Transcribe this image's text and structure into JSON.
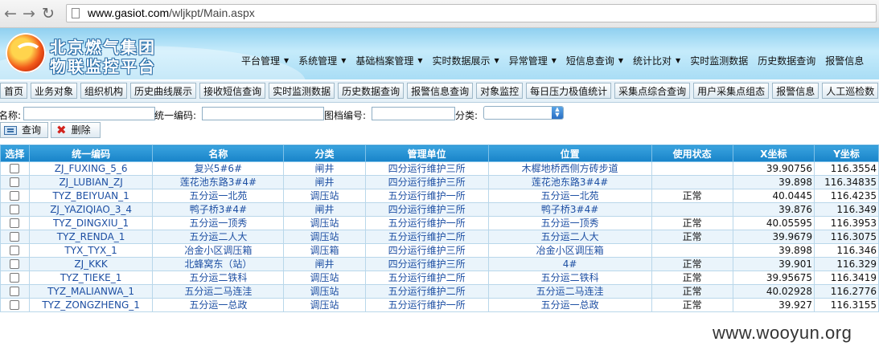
{
  "browser": {
    "url_domain": "www.gasiot.com",
    "url_path": "/wljkpt/Main.aspx"
  },
  "header": {
    "org_name": "北京燃气集团",
    "platform_name": "物联监控平台",
    "menu": [
      {
        "label": "平台管理",
        "dropdown": true
      },
      {
        "label": "系统管理",
        "dropdown": true
      },
      {
        "label": "基础档案管理",
        "dropdown": true
      },
      {
        "label": "实时数据展示",
        "dropdown": true
      },
      {
        "label": "异常管理",
        "dropdown": true
      },
      {
        "label": "短信息查询",
        "dropdown": true
      },
      {
        "label": "统计比对",
        "dropdown": true
      },
      {
        "label": "实时监测数据",
        "dropdown": false
      },
      {
        "label": "历史数据查询",
        "dropdown": false
      },
      {
        "label": "报警信息",
        "dropdown": false
      }
    ]
  },
  "tabs": [
    "首页",
    "业务对象",
    "组织机构",
    "历史曲线展示",
    "接收短信查询",
    "实时监测数据",
    "历史数据查询",
    "报警信息查询",
    "对象监控",
    "每日压力极值统计",
    "采集点综合查询",
    "用户采集点组态",
    "报警信息",
    "人工巡检数"
  ],
  "form": {
    "name_label": "名称:",
    "code_label": "统一编码:",
    "archive_label": "图档编号:",
    "category_label": "分类:",
    "query_button": "查询",
    "delete_button": "删除"
  },
  "table": {
    "headers": [
      "选择",
      "统一编码",
      "名称",
      "分类",
      "管理单位",
      "位置",
      "使用状态",
      "X坐标",
      "Y坐标"
    ],
    "rows": [
      [
        "ZJ_FUXING_5_6",
        "复兴5#6#",
        "闸井",
        "四分运行维护三所",
        "木樨地桥西侧方砖步道",
        "",
        "39.90756",
        "116.3554"
      ],
      [
        "ZJ_LUBIAN_ZJ",
        "莲花池东路3#4#",
        "闸井",
        "四分运行维护三所",
        "莲花池东路3#4#",
        "",
        "39.898",
        "116.34835"
      ],
      [
        "TYZ_BEIYUAN_1",
        "五分运一北苑",
        "调压站",
        "五分运行维护一所",
        "五分运一北苑",
        "正常",
        "40.0445",
        "116.4235"
      ],
      [
        "ZJ_YAZIQIAO_3_4",
        "鸭子桥3#4#",
        "闸井",
        "四分运行维护三所",
        "鸭子桥3#4#",
        "",
        "39.876",
        "116.349"
      ],
      [
        "TYZ_DINGXIU_1",
        "五分运一顶秀",
        "调压站",
        "五分运行维护一所",
        "五分运一顶秀",
        "正常",
        "40.05595",
        "116.3953"
      ],
      [
        "TYZ_RENDA_1",
        "五分运二人大",
        "调压站",
        "五分运行维护二所",
        "五分运二人大",
        "正常",
        "39.9679",
        "116.3075"
      ],
      [
        "TYX_TYX_1",
        "冶金小区调压箱",
        "调压箱",
        "四分运行维护三所",
        "冶金小区调压箱",
        "",
        "39.898",
        "116.346"
      ],
      [
        "ZJ_KKK",
        "北蜂窝东（站）",
        "闸井",
        "四分运行维护三所",
        "4#",
        "正常",
        "39.901",
        "116.329"
      ],
      [
        "TYZ_TIEKE_1",
        "五分运二铁科",
        "调压站",
        "五分运行维护二所",
        "五分运二铁科",
        "正常",
        "39.95675",
        "116.3419"
      ],
      [
        "TYZ_MALIANWA_1",
        "五分运二马连洼",
        "调压站",
        "五分运行维护二所",
        "五分运二马连洼",
        "正常",
        "40.02928",
        "116.2776"
      ],
      [
        "TYZ_ZONGZHENG_1",
        "五分运一总政",
        "调压站",
        "五分运行维护一所",
        "五分运一总政",
        "正常",
        "39.927",
        "116.3155"
      ]
    ]
  },
  "watermark": "www.wooyun.org"
}
